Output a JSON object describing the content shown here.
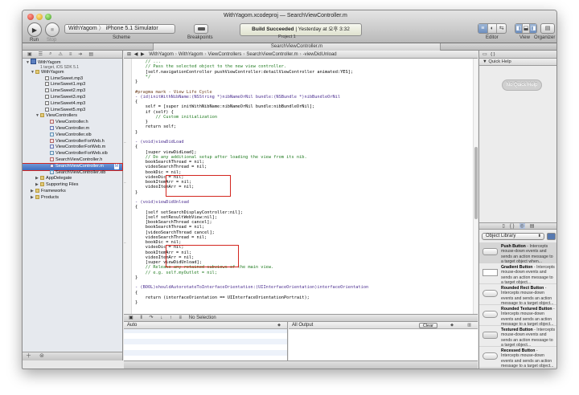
{
  "window": {
    "title_project": "WithYagom.xcodeproj",
    "title_sep": "—",
    "title_file": "SearchViewController.m"
  },
  "toolbar": {
    "run_label": "Run",
    "stop_label": "Stop",
    "scheme_target": "WithYagom",
    "scheme_sep": "〉",
    "scheme_destination": "iPhone 5.1 Simulator",
    "scheme_label": "Scheme",
    "breakpoints_label": "Breakpoints",
    "status_main": "Build Succeeded",
    "status_sep": " | ",
    "status_time": "Yesterday at 오후 3:32",
    "project_label": "Project",
    "project_count": "1",
    "editor_label": "Editor",
    "view_label": "View",
    "organizer_label": "Organizer"
  },
  "tabbar": {
    "active_tab": "SearchViewController.m"
  },
  "navigator": {
    "items": [
      {
        "label": "WithYagom",
        "kind": "proj",
        "indent": 4,
        "disc": "▼"
      },
      {
        "label": "",
        "kind": "sub",
        "indent": 0,
        "disc": ""
      },
      {
        "label": "WithYagom",
        "kind": "folder",
        "indent": 10,
        "disc": "▼"
      },
      {
        "label": "LimeSweet.mp3",
        "kind": "mp3",
        "indent": 22,
        "disc": ""
      },
      {
        "label": "LimeSweet1.mp3",
        "kind": "mp3",
        "indent": 22,
        "disc": ""
      },
      {
        "label": "LimeSweet2.mp3",
        "kind": "mp3",
        "indent": 22,
        "disc": ""
      },
      {
        "label": "LimeSweet3.mp3",
        "kind": "mp3",
        "indent": 22,
        "disc": ""
      },
      {
        "label": "LimeSweet4.mp3",
        "kind": "mp3",
        "indent": 22,
        "disc": ""
      },
      {
        "label": "LimeSweet5.mp3",
        "kind": "mp3",
        "indent": 22,
        "disc": ""
      },
      {
        "label": "ViewControllers",
        "kind": "folder",
        "indent": 16,
        "disc": "▼"
      },
      {
        "label": "ViewController.h",
        "kind": "h",
        "indent": 28,
        "disc": ""
      },
      {
        "label": "ViewController.m",
        "kind": "m",
        "indent": 28,
        "disc": ""
      },
      {
        "label": "ViewController.xib",
        "kind": "xib",
        "indent": 28,
        "disc": ""
      },
      {
        "label": "ViewControllerForWeb.h",
        "kind": "h",
        "indent": 28,
        "disc": ""
      },
      {
        "label": "ViewControllerForWeb.m",
        "kind": "m",
        "indent": 28,
        "disc": ""
      },
      {
        "label": "ViewControllerForWeb.xib",
        "kind": "xib",
        "indent": 28,
        "disc": ""
      },
      {
        "label": "SearchViewController.h",
        "kind": "h",
        "indent": 28,
        "disc": ""
      },
      {
        "label": "SearchViewController.m",
        "kind": "m",
        "indent": 28,
        "disc": "",
        "selected": true,
        "badge": "M"
      },
      {
        "label": "SearchViewController.xib",
        "kind": "xib",
        "indent": 28,
        "disc": ""
      },
      {
        "label": "AppDelegate",
        "kind": "folder",
        "indent": 16,
        "disc": "▶"
      },
      {
        "label": "Supporting Files",
        "kind": "folder",
        "indent": 16,
        "disc": "▶"
      },
      {
        "label": "Frameworks",
        "kind": "folder",
        "indent": 10,
        "disc": "▶"
      },
      {
        "label": "Products",
        "kind": "folder",
        "indent": 10,
        "disc": "▶"
      }
    ],
    "project_subtitle": "1 target, iOS SDK 5.1"
  },
  "jumpbar": {
    "crumbs": [
      "WithYagom",
      "WithYagom",
      "ViewControllers",
      "SearchViewController.m",
      "-viewDidUnload"
    ]
  },
  "code": {
    "lines": [
      "    // ...",
      "    // Pass the selected object to the new view controller.",
      "    [self.navigationController pushViewController:detailViewController animated:YES];",
      "    */",
      "}",
      "",
      "#pragma mark - View Life Cycle",
      "- (id)initWithNibName:(NSString *)nibNameOrNil bundle:(NSBundle *)nibBundleOrNil",
      "{",
      "    self = [super initWithNibName:nibNameOrNil bundle:nibBundleOrNil];",
      "    if (self) {",
      "        // Custom initialization",
      "    }",
      "    return self;",
      "}",
      "",
      "- (void)viewDidLoad",
      "{",
      "    [super viewDidLoad];",
      "    // Do any additional setup after loading the view from its nib.",
      "    bookSearchThread = nil;",
      "    videoSearchThread = nil;",
      "    bookDic = nil;",
      "    videoDic = nil;",
      "    bookItemArr = nil;",
      "    videoItemArr = nil;",
      "}",
      "",
      "- (void)viewDidUnload",
      "{",
      "    [self setSearchDisplayController:nil];",
      "    [self setResultWebView:nil];",
      "    [bookSearchThread cancel];",
      "    bookSearchThread = nil;",
      "    [videoSearchThread cancel];",
      "    videoSearchThread = nil;",
      "    bookDic = nil;",
      "    videoDic = nil;",
      "    bookItemArr = nil;",
      "    videoItemArr = nil;",
      "    [super viewDidUnload];",
      "    // Release any retained subviews of the main view.",
      "    // e.g. self.myOutlet = nil;",
      "}",
      "",
      "- (BOOL)shouldAutorotateToInterfaceOrientation:(UIInterfaceOrientation)interfaceOrientation",
      "{",
      "    return (interfaceOrientation == UIInterfaceOrientationPortrait);",
      "}"
    ]
  },
  "debug": {
    "no_selection": "No Selection",
    "auto_label": "Auto",
    "all_output_label": "All Output",
    "clear_label": "Clear"
  },
  "utilities": {
    "quick_help_title": "Quick Help",
    "no_quick_help": "No Quick Help",
    "library_select": "Object Library",
    "library_items": [
      {
        "title": "Push Button",
        "desc": " - Intercepts mouse-down events and sends an action message to a target object when...",
        "thumb": "btn",
        "selected": true
      },
      {
        "title": "Gradient Button",
        "desc": " - Intercepts mouse-down events and sends an action message to a target object...",
        "thumb": "flat"
      },
      {
        "title": "Rounded Rect Button",
        "desc": " - Intercepts mouse-down events and sends an action message to a target object...",
        "thumb": "pill"
      },
      {
        "title": "Rounded Textured Button",
        "desc": " - Intercepts mouse-down events and sends an action message to a target object...",
        "thumb": "pill"
      },
      {
        "title": "Textured Button",
        "desc": " - Intercepts mouse-down events and sends an action message to a target object...",
        "thumb": "dark"
      },
      {
        "title": "Recessed Button",
        "desc": " - Intercepts mouse-down events and sends an action message to a target object...",
        "thumb": "pill"
      }
    ]
  }
}
